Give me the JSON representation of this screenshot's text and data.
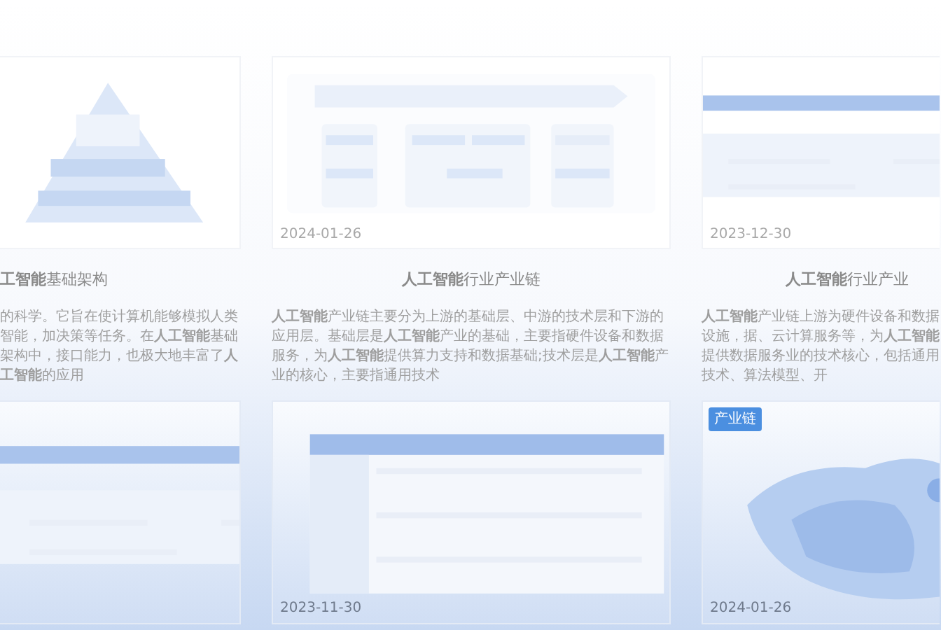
{
  "top_cards": [
    {
      "title": "**工智能**基础架构",
      "description": "的科学。它旨在使计算机能够模拟人类智能，加决策等任务。在**人工智能**基础架构中，接口能力，也极大地丰富了**人工智能**的应用"
    },
    {
      "date": "2024-01-26",
      "title": "**人工智能**行业产业链",
      "description": "**人工智能**产业链主要分为上游的基础层、中游的技术层和下游的应用层。基础层是**人工智能**产业的基础，主要指硬件设备和数据服务，为**人工智能**提供算力支持和数据基础;技术层是**人工智能**产业的核心，主要指通用技术"
    },
    {
      "date": "2023-12-30",
      "title": "**人工智能**行业产业",
      "description": "**人工智能**产业链上游为硬件设备和数据设施，据、云计算服务等，为**人工智能**提供数据服务业的技术核心，包括通用技术、算法模型、开"
    }
  ],
  "bottom_cards": [
    {
      "kind": "picture"
    },
    {
      "kind": "picture",
      "date": "2023-11-30"
    },
    {
      "kind": "picture",
      "date": "2024-01-26",
      "badge": "产业链"
    }
  ]
}
